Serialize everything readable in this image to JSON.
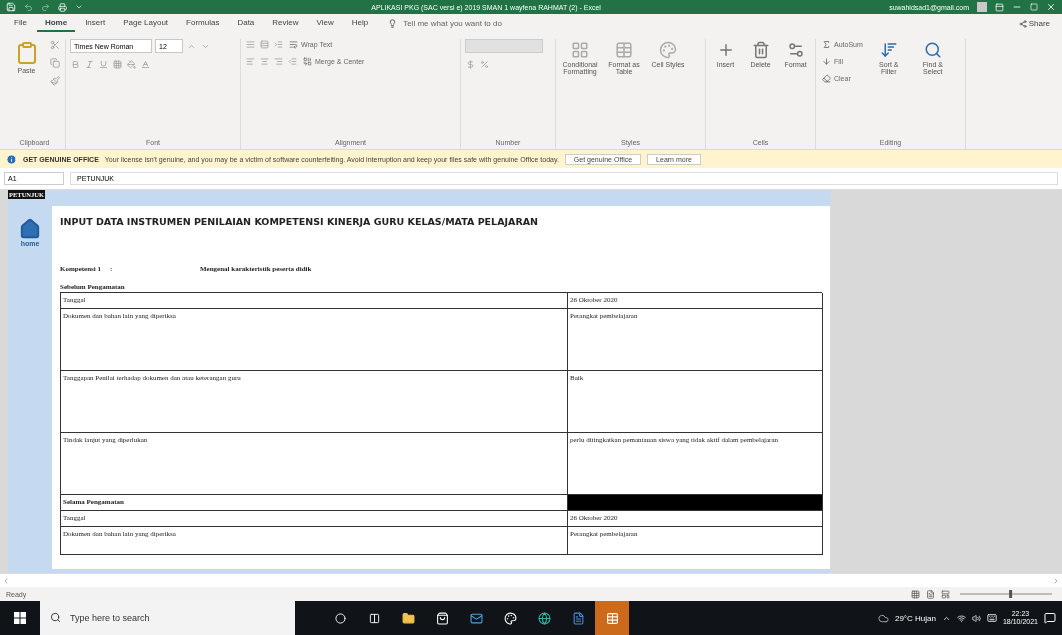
{
  "window": {
    "title": "APLIKASI PKG (SAC versi e) 2019 SMAN 1 wayfena RAHMAT (2) - Excel",
    "account": "suwahidsad1@gmail.com"
  },
  "menu_tabs": [
    {
      "label": "File",
      "selected": false
    },
    {
      "label": "Home",
      "selected": true
    },
    {
      "label": "Insert",
      "selected": false
    },
    {
      "label": "Page Layout",
      "selected": false
    },
    {
      "label": "Formulas",
      "selected": false
    },
    {
      "label": "Data",
      "selected": false
    },
    {
      "label": "Review",
      "selected": false
    },
    {
      "label": "View",
      "selected": false
    },
    {
      "label": "Help",
      "selected": false
    }
  ],
  "tell_me": {
    "placeholder": "Tell me what you want to do"
  },
  "share": "Share",
  "ribbon": {
    "clipboard": {
      "label": "Clipboard",
      "paste": "Paste"
    },
    "font": {
      "label": "Font",
      "name": "Times New Roman",
      "size": "12"
    },
    "alignment": {
      "label": "Alignment",
      "wrap": "Wrap Text",
      "merge": "Merge & Center"
    },
    "number": {
      "label": "Number"
    },
    "styles": {
      "label": "Styles",
      "buttons": [
        "Conditional Formatting",
        "Format as Table",
        "Cell Styles"
      ]
    },
    "cells": {
      "label": "Cells",
      "buttons": [
        "Insert",
        "Delete",
        "Format"
      ]
    },
    "editing": {
      "label": "Editing",
      "small": [
        "AutoSum",
        "Fill",
        "Clear"
      ],
      "large": [
        "Sort & Filter",
        "Find & Select"
      ]
    }
  },
  "message_bar": {
    "title": "GET GENUINE OFFICE",
    "text": "Your license isn't genuine, and you may be a victim of software counterfeiting. Avoid interruption and keep your files safe with genuine Office today.",
    "buttons": [
      "Get genuine Office",
      "Learn more"
    ]
  },
  "formula_bar": {
    "name_box": "A1",
    "value": "PETUNJUK"
  },
  "sheet": {
    "corner_label": "PETUNJUK",
    "home_label": "home",
    "heading": "INPUT DATA INSTRUMEN PENILAIAN KOMPETENSI KINERJA GURU KELAS/MATA PELAJARAN",
    "competency": {
      "label": "Kompetensi 1",
      "separator": ":",
      "value": "Mengenal karakteristik peserta didik"
    },
    "section_title": "Sebelum Pengamatan",
    "rows": [
      {
        "kind": "short",
        "label": "Tanggal",
        "value": "26 Oktober 2020"
      },
      {
        "kind": "tall",
        "label": "Dokumen dan bahan lain yang diperiksa",
        "value": "Perangkat pembelajaran"
      },
      {
        "kind": "tall",
        "label": "Tanggapan Penilai terhadap dokumen dan atau keterangan guru",
        "value": "Baik"
      },
      {
        "kind": "tall",
        "label": "Tindak lanjut yang diperlukan",
        "value": "perlu ditingkatkan pemantauan siswa yang tidak aktif dalam pembelajaran"
      },
      {
        "kind": "section",
        "label": "Selama Pengamatan"
      },
      {
        "kind": "short",
        "label": "Tanggal",
        "value": "26 Oktober 2020"
      },
      {
        "kind": "cut",
        "label": "Dokumen dan bahan lain yang diperiksa",
        "value": "Perangkat pembelajaran"
      }
    ]
  },
  "status_bar": {
    "text": "Ready",
    "zoom": {
      "level": 0.55
    }
  },
  "taskbar": {
    "search_placeholder": "Type here to search",
    "weather": "29°C  Hujan",
    "time": "22:23",
    "date": "18/10/2021"
  }
}
